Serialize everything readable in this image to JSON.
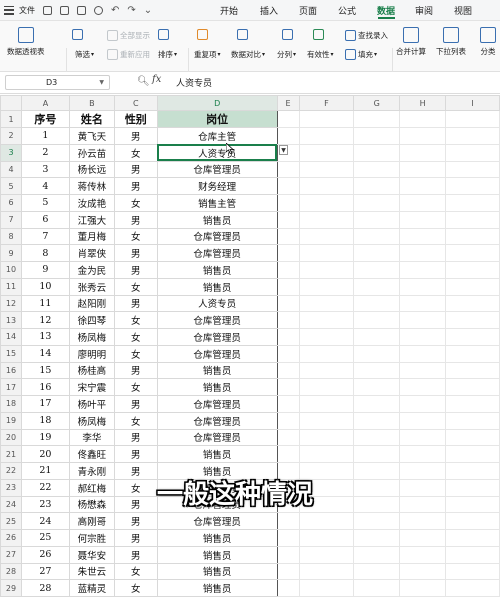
{
  "menubar": {
    "file_label": "文件",
    "tabs": [
      "开始",
      "插入",
      "页面",
      "公式",
      "数据",
      "审阅",
      "视图"
    ],
    "active_tab": "数据"
  },
  "ribbon": {
    "pivot": "数据透视表",
    "filter": "筛选",
    "show_all": "全部显示",
    "reapply": "重新应用",
    "sort": "排序",
    "duplicates": "重复项",
    "compare": "数据对比",
    "split": "分列",
    "validity": "有效性",
    "lookup": "查找录入",
    "fill": "填充",
    "merge_calc": "合并计算",
    "dropdown_list": "下拉列表",
    "group": "分类"
  },
  "formula_bar": {
    "cell_ref": "D3",
    "fx_label": "fx",
    "content": "人资专员"
  },
  "columns": [
    "A",
    "B",
    "C",
    "D",
    "E",
    "F",
    "G",
    "H",
    "I"
  ],
  "headers": {
    "no": "序号",
    "name": "姓名",
    "gender": "性别",
    "position": "岗位"
  },
  "rows": [
    {
      "no": "1",
      "name": "黄飞天",
      "gender": "男",
      "position": "仓库主管"
    },
    {
      "no": "2",
      "name": "孙云苗",
      "gender": "女",
      "position": "人资专员"
    },
    {
      "no": "3",
      "name": "杨长远",
      "gender": "男",
      "position": "仓库管理员"
    },
    {
      "no": "4",
      "name": "蒋传林",
      "gender": "男",
      "position": "财务经理"
    },
    {
      "no": "5",
      "name": "汝成艳",
      "gender": "女",
      "position": "销售主管"
    },
    {
      "no": "6",
      "name": "江强大",
      "gender": "男",
      "position": "销售员"
    },
    {
      "no": "7",
      "name": "董月梅",
      "gender": "女",
      "position": "仓库管理员"
    },
    {
      "no": "8",
      "name": "肖翠侠",
      "gender": "男",
      "position": "仓库管理员"
    },
    {
      "no": "9",
      "name": "金为民",
      "gender": "男",
      "position": "销售员"
    },
    {
      "no": "10",
      "name": "张秀云",
      "gender": "女",
      "position": "销售员"
    },
    {
      "no": "11",
      "name": "赵阳刚",
      "gender": "男",
      "position": "人资专员"
    },
    {
      "no": "12",
      "name": "徐四琴",
      "gender": "女",
      "position": "仓库管理员"
    },
    {
      "no": "13",
      "name": "杨凤梅",
      "gender": "女",
      "position": "仓库管理员"
    },
    {
      "no": "14",
      "name": "廖明明",
      "gender": "女",
      "position": "仓库管理员"
    },
    {
      "no": "15",
      "name": "杨桂高",
      "gender": "男",
      "position": "销售员"
    },
    {
      "no": "16",
      "name": "宋宁震",
      "gender": "女",
      "position": "销售员"
    },
    {
      "no": "17",
      "name": "杨叶平",
      "gender": "男",
      "position": "仓库管理员"
    },
    {
      "no": "18",
      "name": "杨凤梅",
      "gender": "女",
      "position": "仓库管理员"
    },
    {
      "no": "19",
      "name": "李华",
      "gender": "男",
      "position": "仓库管理员"
    },
    {
      "no": "20",
      "name": "佟鑫旺",
      "gender": "男",
      "position": "销售员"
    },
    {
      "no": "21",
      "name": "青永刚",
      "gender": "男",
      "position": "销售员"
    },
    {
      "no": "22",
      "name": "郝红梅",
      "gender": "女",
      "position": "仓库管理员"
    },
    {
      "no": "23",
      "name": "杨懋森",
      "gender": "男",
      "position": "仓库管理员"
    },
    {
      "no": "24",
      "name": "高刚哥",
      "gender": "男",
      "position": "仓库管理员"
    },
    {
      "no": "25",
      "name": "何宗胜",
      "gender": "男",
      "position": "销售员"
    },
    {
      "no": "26",
      "name": "聂华安",
      "gender": "男",
      "position": "销售员"
    },
    {
      "no": "27",
      "name": "朱世云",
      "gender": "女",
      "position": "销售员"
    },
    {
      "no": "28",
      "name": "蓝精灵",
      "gender": "女",
      "position": "销售员"
    }
  ],
  "subtitle": "一般这种情况",
  "colors": {
    "accent": "#1a7f4b",
    "header_row_bg": "#f2f2f2",
    "selected_header_bg": "#dfe8e3"
  }
}
